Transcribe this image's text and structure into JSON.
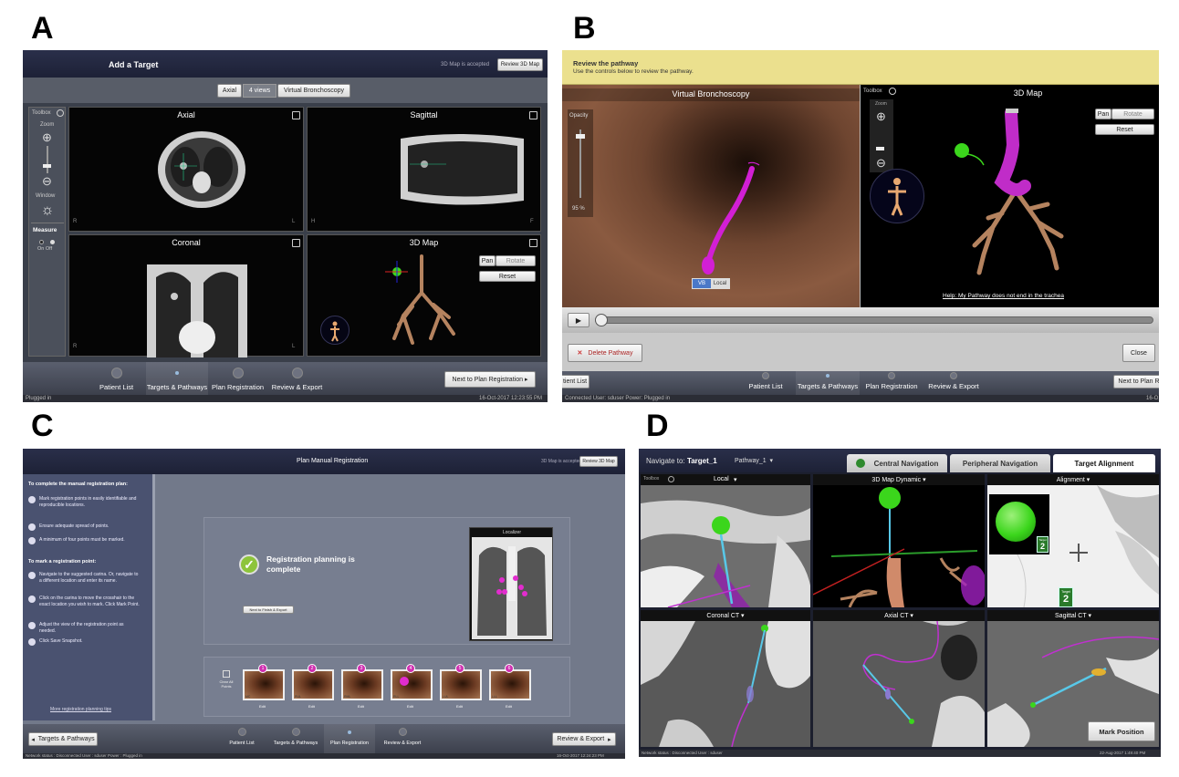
{
  "labels": {
    "a": "A",
    "b": "B",
    "c": "C",
    "d": "D"
  },
  "panel_a": {
    "title": "Add a Target",
    "status": "3D Map is accepted",
    "review_button": "Review 3D Map",
    "view_tabs": [
      "Axial",
      "4 views",
      "Virtual Bronchoscopy"
    ],
    "toolbox": "Toolbox",
    "zoom": "Zoom",
    "window": "Window",
    "measure": "Measure",
    "on_off": "On Off",
    "views": [
      "Axial",
      "Sagittal",
      "Coronal",
      "3D Map"
    ],
    "corner_letters": {
      "axial_l": "R",
      "axial_r": "L",
      "sag_l": "H",
      "sag_r": "F",
      "cor_l": "R",
      "cor_r": "L"
    },
    "pan": "Pan",
    "rotate": "Rotate",
    "reset": "Reset",
    "steps": [
      "Patient List",
      "Targets & Pathways",
      "Plan Registration",
      "Review & Export"
    ],
    "next_button": "Next to Plan Registration",
    "status_left": "Plugged in",
    "timestamp": "16-Oct-2017 12:23:55 PM"
  },
  "panel_b": {
    "header_title": "Review the pathway",
    "header_sub": "Use the controls below to review the pathway.",
    "vb_title": "Virtual Bronchoscopy",
    "map_title": "3D Map",
    "opacity": "Opacity",
    "opacity_value": "95 %",
    "toolbox": "Toolbox",
    "vb_toggle": [
      "VB",
      "Local"
    ],
    "pan": "Pan",
    "rotate": "Rotate",
    "reset": "Reset",
    "help_link": "Help: My Pathway does not end in the trachea",
    "delete_button": "Delete Pathway",
    "close_button": "Close",
    "steps": [
      "Patient List",
      "Targets & Pathways",
      "Plan Registration",
      "Review & Export"
    ],
    "left_button": "tient List",
    "next_button": "Next to Plan R",
    "status": "Connected   User:  sduser   Power:  Plugged in",
    "timestamp": "16-O"
  },
  "panel_c": {
    "title": "Plan Manual Registration",
    "status": "3D Map is accepted",
    "review_button": "Review 3D Map",
    "instr_heading1": "To complete the manual registration plan:",
    "instr_items1": [
      "Mark registration points in easily identifiable and reproducible locations.",
      "Ensure adequate spread of points.",
      "A minimum of four points must be marked."
    ],
    "instr_heading2": "To mark a registration point:",
    "instr_items2": [
      "Navigate to the suggested carina. Or, navigate to a different location and enter its name.",
      "Click on the carina to move the crosshair to the exact location you wish to mark. Click Mark Point.",
      "Adjust the view of the registration point as needed.",
      "Click Save Snapshot."
    ],
    "tips_link": "More registration planning tips",
    "complete_text": "Registration planning is complete",
    "next_small": "Next to Finish & Export",
    "localizer": "Localizer",
    "clear_all": "Clear All Points",
    "thumbs": [
      {
        "num": "1",
        "label": "MC",
        "edit": "Edit"
      },
      {
        "num": "2",
        "label": "RUL",
        "edit": "Edit"
      },
      {
        "num": "3",
        "label": "RML",
        "edit": "Edit"
      },
      {
        "num": "4",
        "label": "RLL",
        "edit": "Edit"
      },
      {
        "num": "5",
        "label": "LUL",
        "edit": "Edit"
      },
      {
        "num": "6",
        "label": "LLL",
        "edit": "Edit"
      }
    ],
    "back_button": "Targets & Pathways",
    "steps": [
      "Patient List",
      "Targets & Pathways",
      "Plan Registration",
      "Review & Export"
    ],
    "next_button": "Review & Export",
    "status_left": "Network status : Disconnected   User : sduser   Power : Plugged in",
    "timestamp": "16-Oct-2017 12:24:23 PM"
  },
  "panel_d": {
    "navigate_label": "Navigate to:",
    "target": "Target_1",
    "pathway": "Pathway_1",
    "tabs": [
      "Central Navigation",
      "Peripheral Navigation",
      "Target Alignment"
    ],
    "toolbox": "Toolbox",
    "views": [
      "Local",
      "3D Map Dynamic",
      "Alignment",
      "Coronal CT",
      "Axial CT",
      "Sagittal CT"
    ],
    "target_badge": "2",
    "target_badge_label": "Target",
    "mark_position": "Mark Position",
    "status_left": "Network status : Disconnected   User : sduser",
    "timestamp": "22-Aug-2017 1:49:40 PM"
  },
  "colors": {
    "title_bar": "#22263d",
    "pathway_magenta": "#d21fd4",
    "target_green": "#3bd61c",
    "airway_tan": "#b5835f",
    "header_yellow": "#ebe08e",
    "checkmark_green": "#8dc43b",
    "tab_active_white": "#ffffff"
  }
}
